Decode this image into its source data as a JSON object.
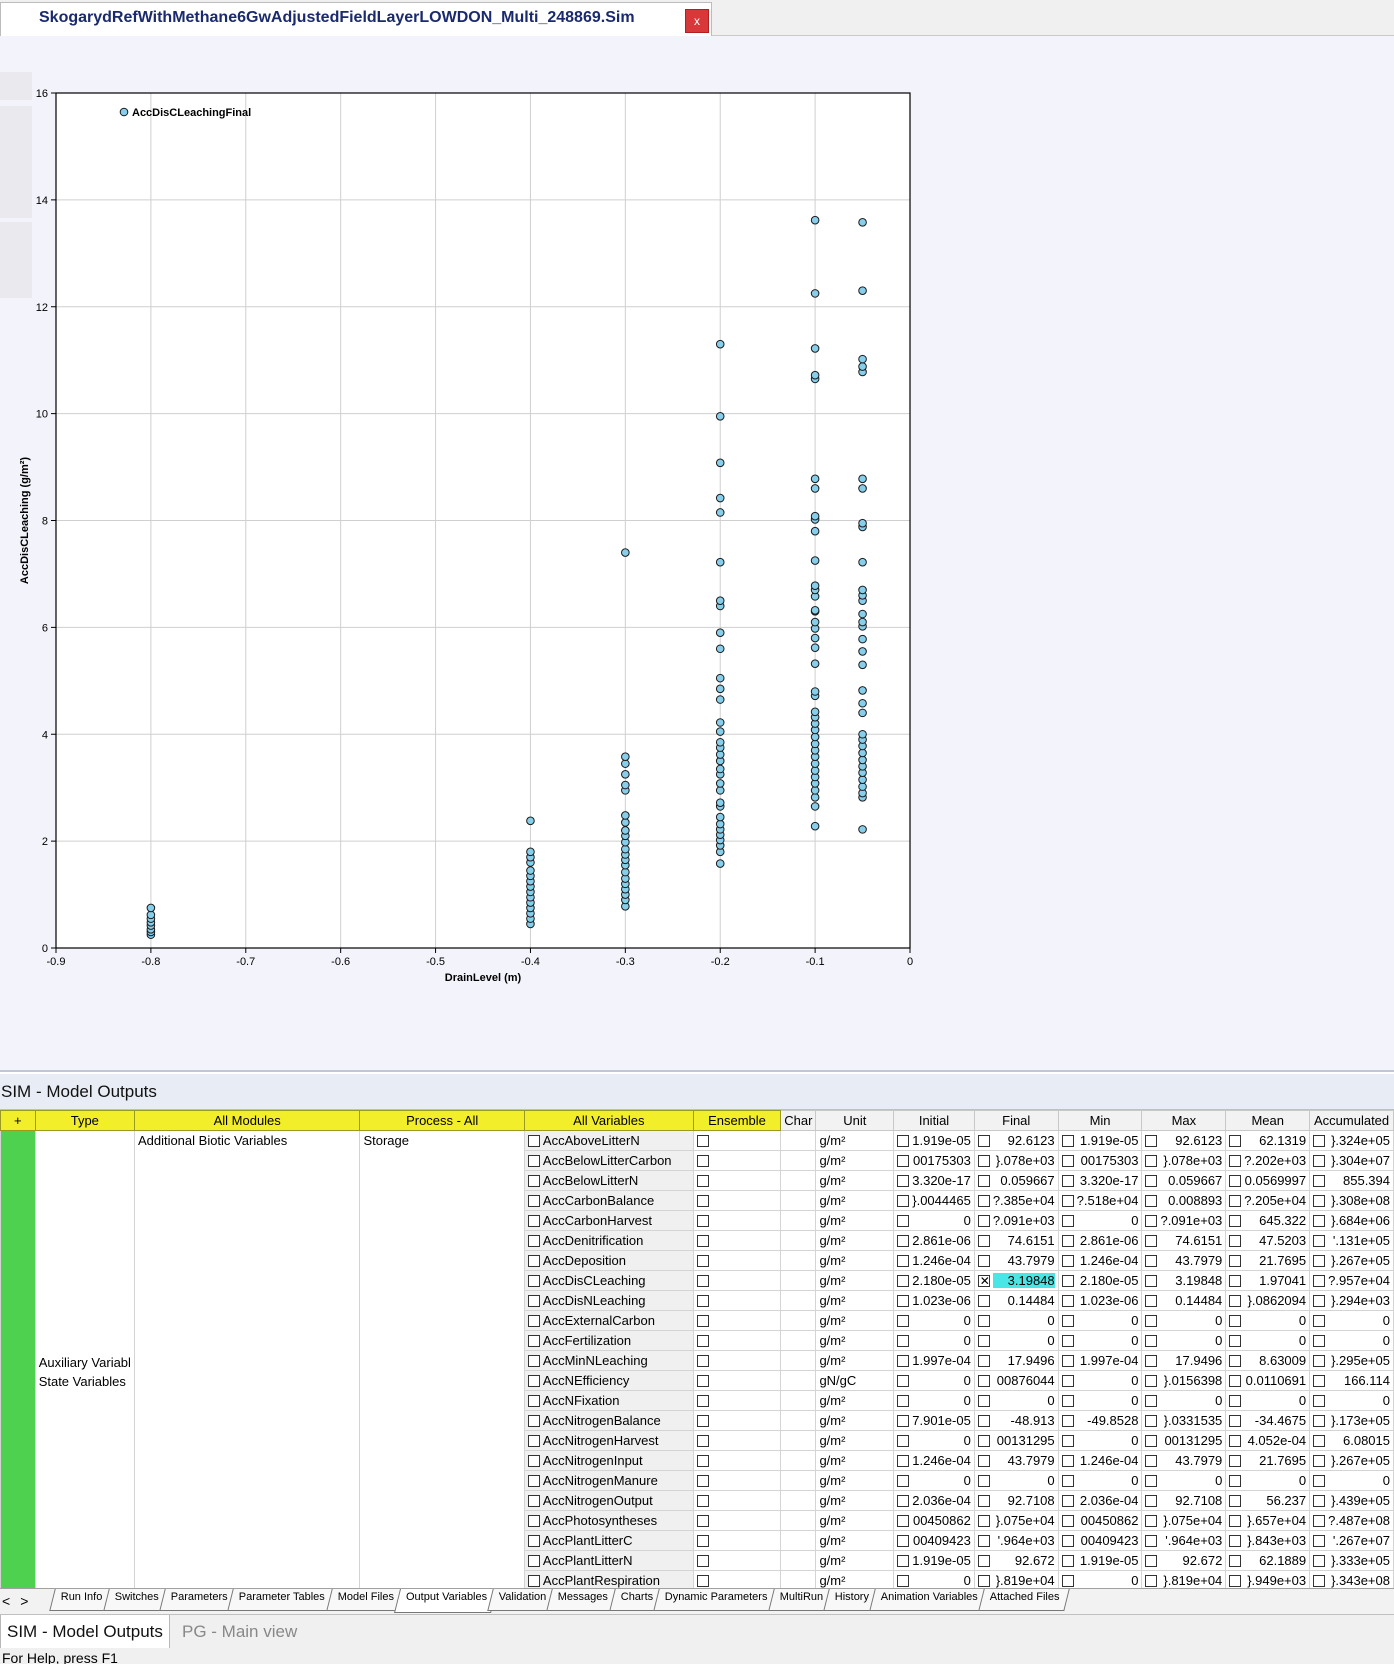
{
  "document_tab": {
    "title": "SkogarydRefWithMethane6GwAdjustedFieldLayerLOWDON_Multi_248869.Sim",
    "close_label": "x"
  },
  "chart_data": {
    "type": "scatter",
    "xlabel": "DrainLevel (m)",
    "ylabel": "AccDisCLeaching (g/m²)",
    "xlim": [
      -0.9,
      0
    ],
    "ylim": [
      0,
      16
    ],
    "x_ticks": [
      "-0.9",
      "-0.8",
      "-0.7",
      "-0.6",
      "-0.5",
      "-0.4",
      "-0.3",
      "-0.2",
      "-0.1",
      "0"
    ],
    "y_ticks": [
      "0",
      "2",
      "4",
      "6",
      "8",
      "10",
      "12",
      "14",
      "16"
    ],
    "grid": true,
    "legend_position": "top-left",
    "marker_color": "#87ceeb",
    "series": [
      {
        "name": "AccDisCLeachingFinal",
        "points": [
          [
            -0.8,
            0.25
          ],
          [
            -0.8,
            0.3
          ],
          [
            -0.8,
            0.35
          ],
          [
            -0.8,
            0.42
          ],
          [
            -0.8,
            0.48
          ],
          [
            -0.8,
            0.55
          ],
          [
            -0.8,
            0.62
          ],
          [
            -0.8,
            0.75
          ],
          [
            -0.4,
            0.45
          ],
          [
            -0.4,
            0.55
          ],
          [
            -0.4,
            0.65
          ],
          [
            -0.4,
            0.75
          ],
          [
            -0.4,
            0.85
          ],
          [
            -0.4,
            0.95
          ],
          [
            -0.4,
            1.05
          ],
          [
            -0.4,
            1.15
          ],
          [
            -0.4,
            1.25
          ],
          [
            -0.4,
            1.35
          ],
          [
            -0.4,
            1.45
          ],
          [
            -0.4,
            1.6
          ],
          [
            -0.4,
            1.7
          ],
          [
            -0.4,
            1.8
          ],
          [
            -0.4,
            2.38
          ],
          [
            -0.3,
            0.78
          ],
          [
            -0.3,
            0.9
          ],
          [
            -0.3,
            1.0
          ],
          [
            -0.3,
            1.1
          ],
          [
            -0.3,
            1.2
          ],
          [
            -0.3,
            1.3
          ],
          [
            -0.3,
            1.42
          ],
          [
            -0.3,
            1.55
          ],
          [
            -0.3,
            1.65
          ],
          [
            -0.3,
            1.75
          ],
          [
            -0.3,
            1.85
          ],
          [
            -0.3,
            1.98
          ],
          [
            -0.3,
            2.1
          ],
          [
            -0.3,
            2.2
          ],
          [
            -0.3,
            2.35
          ],
          [
            -0.3,
            2.48
          ],
          [
            -0.3,
            2.95
          ],
          [
            -0.3,
            3.05
          ],
          [
            -0.3,
            3.25
          ],
          [
            -0.3,
            3.45
          ],
          [
            -0.3,
            3.58
          ],
          [
            -0.3,
            7.4
          ],
          [
            -0.2,
            1.58
          ],
          [
            -0.2,
            1.8
          ],
          [
            -0.2,
            1.92
          ],
          [
            -0.2,
            2.02
          ],
          [
            -0.2,
            2.12
          ],
          [
            -0.2,
            2.22
          ],
          [
            -0.2,
            2.32
          ],
          [
            -0.2,
            2.45
          ],
          [
            -0.2,
            2.65
          ],
          [
            -0.2,
            2.72
          ],
          [
            -0.2,
            2.95
          ],
          [
            -0.2,
            3.08
          ],
          [
            -0.2,
            3.25
          ],
          [
            -0.2,
            3.35
          ],
          [
            -0.2,
            3.5
          ],
          [
            -0.2,
            3.62
          ],
          [
            -0.2,
            3.75
          ],
          [
            -0.2,
            3.85
          ],
          [
            -0.2,
            4.05
          ],
          [
            -0.2,
            4.22
          ],
          [
            -0.2,
            4.65
          ],
          [
            -0.2,
            4.85
          ],
          [
            -0.2,
            5.05
          ],
          [
            -0.2,
            5.6
          ],
          [
            -0.2,
            5.9
          ],
          [
            -0.2,
            6.4
          ],
          [
            -0.2,
            6.5
          ],
          [
            -0.2,
            7.22
          ],
          [
            -0.2,
            8.15
          ],
          [
            -0.2,
            8.42
          ],
          [
            -0.2,
            9.08
          ],
          [
            -0.2,
            9.95
          ],
          [
            -0.2,
            11.3
          ],
          [
            -0.1,
            2.28
          ],
          [
            -0.1,
            2.65
          ],
          [
            -0.1,
            2.82
          ],
          [
            -0.1,
            2.95
          ],
          [
            -0.1,
            3.08
          ],
          [
            -0.1,
            3.2
          ],
          [
            -0.1,
            3.32
          ],
          [
            -0.1,
            3.45
          ],
          [
            -0.1,
            3.58
          ],
          [
            -0.1,
            3.7
          ],
          [
            -0.1,
            3.82
          ],
          [
            -0.1,
            3.95
          ],
          [
            -0.1,
            4.08
          ],
          [
            -0.1,
            4.2
          ],
          [
            -0.1,
            4.32
          ],
          [
            -0.1,
            4.42
          ],
          [
            -0.1,
            4.72
          ],
          [
            -0.1,
            4.8
          ],
          [
            -0.1,
            5.32
          ],
          [
            -0.1,
            5.62
          ],
          [
            -0.1,
            5.8
          ],
          [
            -0.1,
            5.98
          ],
          [
            -0.1,
            6.1
          ],
          [
            -0.1,
            6.3
          ],
          [
            -0.1,
            6.32
          ],
          [
            -0.1,
            6.58
          ],
          [
            -0.1,
            6.7
          ],
          [
            -0.1,
            6.78
          ],
          [
            -0.1,
            7.25
          ],
          [
            -0.1,
            7.8
          ],
          [
            -0.1,
            8.02
          ],
          [
            -0.1,
            8.08
          ],
          [
            -0.1,
            8.6
          ],
          [
            -0.1,
            8.78
          ],
          [
            -0.1,
            10.65
          ],
          [
            -0.1,
            10.72
          ],
          [
            -0.1,
            11.22
          ],
          [
            -0.1,
            12.25
          ],
          [
            -0.1,
            13.62
          ],
          [
            -0.05,
            2.22
          ],
          [
            -0.05,
            2.82
          ],
          [
            -0.05,
            2.9
          ],
          [
            -0.05,
            3.02
          ],
          [
            -0.05,
            3.15
          ],
          [
            -0.05,
            3.28
          ],
          [
            -0.05,
            3.4
          ],
          [
            -0.05,
            3.52
          ],
          [
            -0.05,
            3.65
          ],
          [
            -0.05,
            3.78
          ],
          [
            -0.05,
            3.9
          ],
          [
            -0.05,
            4.0
          ],
          [
            -0.05,
            4.4
          ],
          [
            -0.05,
            4.58
          ],
          [
            -0.05,
            4.82
          ],
          [
            -0.05,
            5.3
          ],
          [
            -0.05,
            5.55
          ],
          [
            -0.05,
            5.78
          ],
          [
            -0.05,
            6.02
          ],
          [
            -0.05,
            6.1
          ],
          [
            -0.05,
            6.25
          ],
          [
            -0.05,
            6.5
          ],
          [
            -0.05,
            6.6
          ],
          [
            -0.05,
            6.7
          ],
          [
            -0.05,
            7.22
          ],
          [
            -0.05,
            7.88
          ],
          [
            -0.05,
            7.95
          ],
          [
            -0.05,
            8.6
          ],
          [
            -0.05,
            8.78
          ],
          [
            -0.05,
            10.78
          ],
          [
            -0.05,
            10.88
          ],
          [
            -0.05,
            11.02
          ],
          [
            -0.05,
            12.3
          ],
          [
            -0.05,
            13.58
          ]
        ]
      }
    ]
  },
  "panel": {
    "title": "SIM - Model Outputs"
  },
  "columns": {
    "plus": "+",
    "type": "Type",
    "modules": "All Modules",
    "process": "Process - All",
    "variables": "All Variables",
    "ensemble": "Ensemble",
    "chart": "Char",
    "unit": "Unit",
    "initial": "Initial",
    "final": "Final",
    "min": "Min",
    "max": "Max",
    "mean": "Mean",
    "accumulated": "Accumulated"
  },
  "group": {
    "module": "Additional Biotic Variables",
    "process": "Storage",
    "type_lines": [
      "Auxiliary Variabl",
      "State Variables"
    ]
  },
  "rows": [
    {
      "name": "AccAboveLitterN",
      "unit": "g/m²",
      "initial": "1.919e-05",
      "final": "92.6123",
      "min": "1.919e-05",
      "max": "92.6123",
      "mean": "62.1319",
      "accumulated": "}.324e+05"
    },
    {
      "name": "AccBelowLitterCarbon",
      "unit": "g/m²",
      "initial": "00175303",
      "final": "}.078e+03",
      "min": "00175303",
      "max": "}.078e+03",
      "mean": "?.202e+03",
      "accumulated": "}.304e+07"
    },
    {
      "name": "AccBelowLitterN",
      "unit": "g/m²",
      "initial": "3.320e-17",
      "final": "0.059667",
      "min": "3.320e-17",
      "max": "0.059667",
      "mean": "0.0569997",
      "accumulated": "855.394"
    },
    {
      "name": "AccCarbonBalance",
      "unit": "g/m²",
      "initial": "}.0044465",
      "final": "?.385e+04",
      "min": "?.518e+04",
      "max": "0.008893",
      "mean": "?.205e+04",
      "accumulated": "}.308e+08"
    },
    {
      "name": "AccCarbonHarvest",
      "unit": "g/m²",
      "initial": "0",
      "final": "?.091e+03",
      "min": "0",
      "max": "?.091e+03",
      "mean": "645.322",
      "accumulated": "}.684e+06"
    },
    {
      "name": "AccDenitrification",
      "unit": "g/m²",
      "initial": "2.861e-06",
      "final": "74.6151",
      "min": "2.861e-06",
      "max": "74.6151",
      "mean": "47.5203",
      "accumulated": "'.131e+05"
    },
    {
      "name": "AccDeposition",
      "unit": "g/m²",
      "initial": "1.246e-04",
      "final": "43.7979",
      "min": "1.246e-04",
      "max": "43.7979",
      "mean": "21.7695",
      "accumulated": "}.267e+05"
    },
    {
      "name": "AccDisCLeaching",
      "unit": "g/m²",
      "initial": "2.180e-05",
      "final": "3.19848",
      "min": "2.180e-05",
      "max": "3.19848",
      "mean": "1.97041",
      "accumulated": "?.957e+04",
      "final_checked": true
    },
    {
      "name": "AccDisNLeaching",
      "unit": "g/m²",
      "initial": "1.023e-06",
      "final": "0.14484",
      "min": "1.023e-06",
      "max": "0.14484",
      "mean": "}.0862094",
      "accumulated": "}.294e+03"
    },
    {
      "name": "AccExternalCarbon",
      "unit": "g/m²",
      "initial": "0",
      "final": "0",
      "min": "0",
      "max": "0",
      "mean": "0",
      "accumulated": "0"
    },
    {
      "name": "AccFertilization",
      "unit": "g/m²",
      "initial": "0",
      "final": "0",
      "min": "0",
      "max": "0",
      "mean": "0",
      "accumulated": "0"
    },
    {
      "name": "AccMinNLeaching",
      "unit": "g/m²",
      "initial": "1.997e-04",
      "final": "17.9496",
      "min": "1.997e-04",
      "max": "17.9496",
      "mean": "8.63009",
      "accumulated": "}.295e+05"
    },
    {
      "name": "AccNEfficiency",
      "unit": "gN/gC",
      "initial": "0",
      "final": "00876044",
      "min": "0",
      "max": "}.0156398",
      "mean": "0.0110691",
      "accumulated": "166.114"
    },
    {
      "name": "AccNFixation",
      "unit": "g/m²",
      "initial": "0",
      "final": "0",
      "min": "0",
      "max": "0",
      "mean": "0",
      "accumulated": "0"
    },
    {
      "name": "AccNitrogenBalance",
      "unit": "g/m²",
      "initial": "7.901e-05",
      "final": "-48.913",
      "min": "-49.8528",
      "max": "}.0331535",
      "mean": "-34.4675",
      "accumulated": "}.173e+05"
    },
    {
      "name": "AccNitrogenHarvest",
      "unit": "g/m²",
      "initial": "0",
      "final": "00131295",
      "min": "0",
      "max": "00131295",
      "mean": "4.052e-04",
      "accumulated": "6.08015"
    },
    {
      "name": "AccNitrogenInput",
      "unit": "g/m²",
      "initial": "1.246e-04",
      "final": "43.7979",
      "min": "1.246e-04",
      "max": "43.7979",
      "mean": "21.7695",
      "accumulated": "}.267e+05"
    },
    {
      "name": "AccNitrogenManure",
      "unit": "g/m²",
      "initial": "0",
      "final": "0",
      "min": "0",
      "max": "0",
      "mean": "0",
      "accumulated": "0"
    },
    {
      "name": "AccNitrogenOutput",
      "unit": "g/m²",
      "initial": "2.036e-04",
      "final": "92.7108",
      "min": "2.036e-04",
      "max": "92.7108",
      "mean": "56.237",
      "accumulated": "}.439e+05"
    },
    {
      "name": "AccPhotosyntheses",
      "unit": "g/m²",
      "initial": "00450862",
      "final": "}.075e+04",
      "min": "00450862",
      "max": "}.075e+04",
      "mean": "}.657e+04",
      "accumulated": "?.487e+08"
    },
    {
      "name": "AccPlantLitterC",
      "unit": "g/m²",
      "initial": "00409423",
      "final": "'.964e+03",
      "min": "00409423",
      "max": "'.964e+03",
      "mean": "}.843e+03",
      "accumulated": "'.267e+07"
    },
    {
      "name": "AccPlantLitterN",
      "unit": "g/m²",
      "initial": "1.919e-05",
      "final": "92.672",
      "min": "1.919e-05",
      "max": "92.672",
      "mean": "62.1889",
      "accumulated": "}.333e+05"
    },
    {
      "name": "AccPlantRespiration",
      "unit": "g/m²",
      "initial": "0",
      "final": "}.819e+04",
      "min": "0",
      "max": "}.819e+04",
      "mean": "}.949e+03",
      "accumulated": "}.343e+08"
    }
  ],
  "tab_nav": {
    "prev": "<",
    "next": ">"
  },
  "tabs": [
    "Run Info",
    "Switches",
    "Parameters",
    "Parameter Tables",
    "Model Files",
    "Output Variables",
    "Validation",
    "Messages",
    "Charts",
    "Dynamic Parameters",
    "MultiRun",
    "History",
    "Animation Variables",
    "Attached Files"
  ],
  "active_tab": "Output Variables",
  "bottom_tabs": {
    "active": "SIM - Model Outputs",
    "inactive": "PG - Main view"
  },
  "status": {
    "text": "For Help, press F1"
  }
}
